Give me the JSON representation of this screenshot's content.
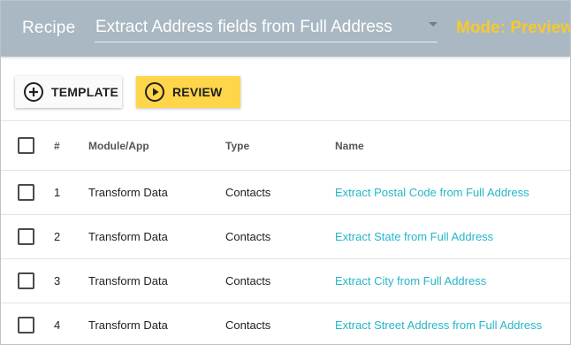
{
  "header": {
    "recipe_label": "Recipe",
    "recipe_select_value": "Extract Address fields from Full Address",
    "mode_text": "Mode: Preview",
    "mode_color": "#f7c92f",
    "background_color": "#a9b8c3"
  },
  "toolbar": {
    "template_label": "TEMPLATE",
    "template_icon": "add-circle-icon",
    "review_label": "REVIEW",
    "review_icon": "play-circle-icon",
    "review_color": "#ffd54a"
  },
  "table": {
    "columns": [
      "#",
      "Module/App",
      "Type",
      "Name"
    ],
    "link_color": "#26b6c8",
    "rows": [
      {
        "num": "1",
        "module": "Transform Data",
        "type": "Contacts",
        "name": "Extract Postal Code from Full Address"
      },
      {
        "num": "2",
        "module": "Transform Data",
        "type": "Contacts",
        "name": "Extract State from Full Address"
      },
      {
        "num": "3",
        "module": "Transform Data",
        "type": "Contacts",
        "name": "Extract City from Full Address"
      },
      {
        "num": "4",
        "module": "Transform Data",
        "type": "Contacts",
        "name": "Extract Street Address from Full Address"
      }
    ]
  }
}
